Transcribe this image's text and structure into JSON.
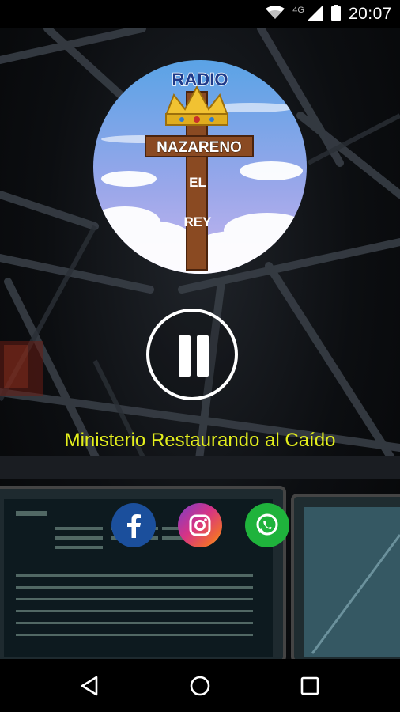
{
  "status_bar": {
    "time": "20:07",
    "network_label": "4G",
    "icons": [
      "wifi-icon",
      "cell-signal-icon",
      "battery-icon"
    ]
  },
  "logo": {
    "top_text": "RADIO",
    "plank_text": "NAZARENO",
    "vertical_text": [
      "EL",
      "REY"
    ],
    "icons": [
      "crown-icon"
    ]
  },
  "player": {
    "state_icon": "pause-icon"
  },
  "slogan": "Ministerio Restaurando al Caído",
  "social": [
    {
      "name": "facebook",
      "icon": "facebook-icon",
      "color": "#1b4f9c"
    },
    {
      "name": "instagram",
      "icon": "instagram-icon",
      "color": "#d63386"
    },
    {
      "name": "whatsapp",
      "icon": "whatsapp-icon",
      "color": "#1fb33c"
    }
  ],
  "nav_bar": {
    "icons": [
      "back-triangle-icon",
      "home-circle-icon",
      "recents-square-icon"
    ]
  },
  "colors": {
    "slogan": "#e3ee1c",
    "background": "#0c0e11"
  }
}
